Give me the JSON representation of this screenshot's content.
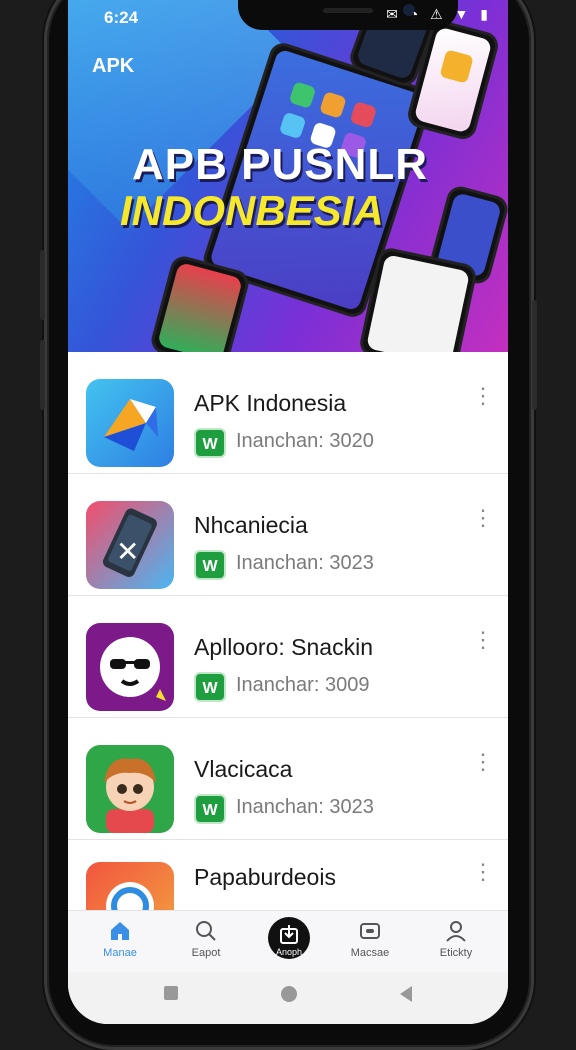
{
  "status_bar": {
    "time": "6:24",
    "icons": "✉ ◔ ⚠ ▼ ▮"
  },
  "hero": {
    "tag": "APK",
    "title": "APB PUSNLR",
    "subtitle": "INDONBESIA"
  },
  "apps": [
    {
      "name": "APK Indonesia",
      "badge": "W",
      "meta": "Inanchan: 3020",
      "icon": "folded-paper-icon"
    },
    {
      "name": "Nhcaniecia",
      "badge": "W",
      "meta": "Inanchan: 3023",
      "icon": "phone-x-icon"
    },
    {
      "name": "Aplloorо: Snackin",
      "badge": "W",
      "meta": "Inanchar: 3009",
      "icon": "sunglasses-face-icon"
    },
    {
      "name": "Vlacicaca",
      "badge": "W",
      "meta": "Inanchan: 3023",
      "icon": "cartoon-face-icon"
    },
    {
      "name": "Papaburdeois",
      "badge": "",
      "meta": "",
      "icon": "camera-ring-icon"
    }
  ],
  "bottom_nav": [
    {
      "label": "Manae",
      "icon": "home-icon",
      "active": true
    },
    {
      "label": "Eapot",
      "icon": "search-icon",
      "active": false
    },
    {
      "label": "Anoph",
      "icon": "download-icon",
      "active": false
    },
    {
      "label": "Macsae",
      "icon": "message-icon",
      "active": false
    },
    {
      "label": "Etickty",
      "icon": "profile-icon",
      "active": false
    }
  ],
  "colors": {
    "accent": "#3a8ee6",
    "badge": "#1e9e3e",
    "title_yellow": "#f6e82a"
  }
}
